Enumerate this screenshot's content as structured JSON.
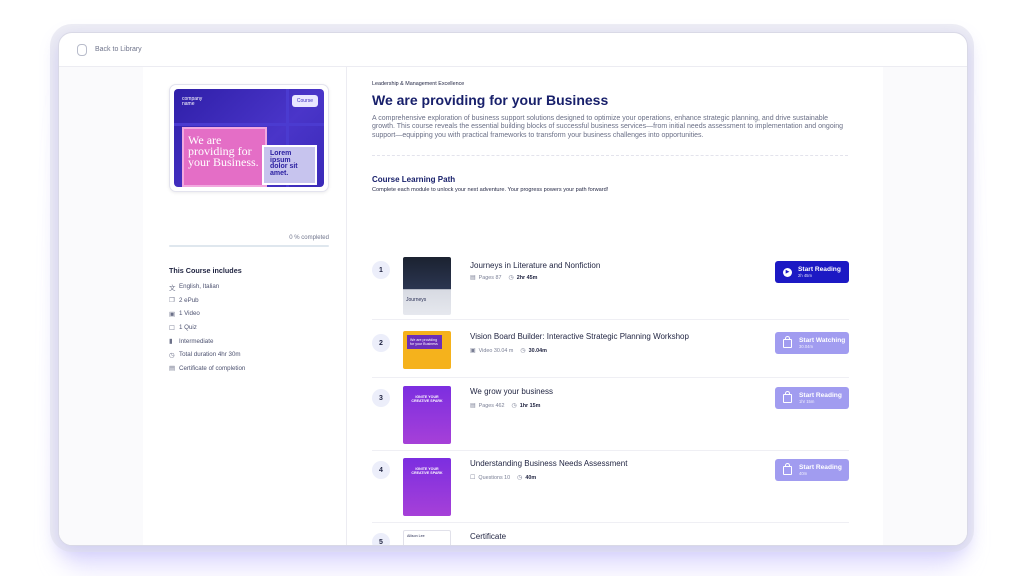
{
  "nav": {
    "back_label": "Back to Library"
  },
  "course_card": {
    "logo_text": "company name",
    "badge_label": "Course",
    "headline": "We are providing for your Business.",
    "sub_headline": "Lorem ipsum dolor sit amet.",
    "progress_percent": 0,
    "progress_label": "0 % completed"
  },
  "includes": {
    "title": "This Course includes",
    "items": [
      {
        "icon": "language-icon",
        "label": "English, Italian"
      },
      {
        "icon": "epub-icon",
        "label": "2 ePub"
      },
      {
        "icon": "video-icon",
        "label": "1 Video"
      },
      {
        "icon": "quiz-icon",
        "label": "1 Quiz"
      },
      {
        "icon": "level-icon",
        "label": "Intermediate"
      },
      {
        "icon": "clock-icon",
        "label": "Total duration 4hr 30m"
      },
      {
        "icon": "certificate-icon",
        "label": "Certificate of completion"
      }
    ]
  },
  "header": {
    "kicker": "Leadership & Management Excellence",
    "title": "We are providing for your Business",
    "description": "A comprehensive exploration of business support solutions designed to optimize your operations, enhance strategic planning, and drive sustainable growth. This course reveals the essential building blocks of successful business services—from initial needs assessment to implementation and ongoing support—equipping you with practical frameworks to transform your business challenges into opportunities."
  },
  "learning_path": {
    "title": "Course Learning Path",
    "subtitle": "Complete each module to unlock your next adventure. Your progress powers your path forward!",
    "modules": [
      {
        "number": "1",
        "title": "Journeys in Literature and Nonfiction",
        "meta": "Pages 87",
        "duration": "2hr 45m",
        "action_label": "Start Reading",
        "action_duration": "2h 45m",
        "locked": false,
        "thumb_text": "Journeys"
      },
      {
        "number": "2",
        "title": "Vision Board Builder: Interactive Strategic Planning Workshop",
        "meta": "Video 30.04 m",
        "duration": "30.04m",
        "action_label": "Start Watching",
        "action_duration": "30.04m",
        "locked": true,
        "thumb_text": "We are providing for your Business"
      },
      {
        "number": "3",
        "title": "We grow your business",
        "meta": "Pages 462",
        "duration": "1hr 15m",
        "action_label": "Start Reading",
        "action_duration": "1hr 15m",
        "locked": true,
        "thumb_text": "IGNITE YOUR CREATIVE SPARK"
      },
      {
        "number": "4",
        "title": "Understanding Business Needs Assessment",
        "meta": "Questions 10",
        "duration": "40m",
        "action_label": "Start Reading",
        "action_duration": "40m",
        "locked": true,
        "thumb_text": "IGNITE YOUR CREATIVE SPARK"
      },
      {
        "number": "5",
        "title": "Certificate",
        "thumb_text": "Allison Lee"
      }
    ]
  }
}
